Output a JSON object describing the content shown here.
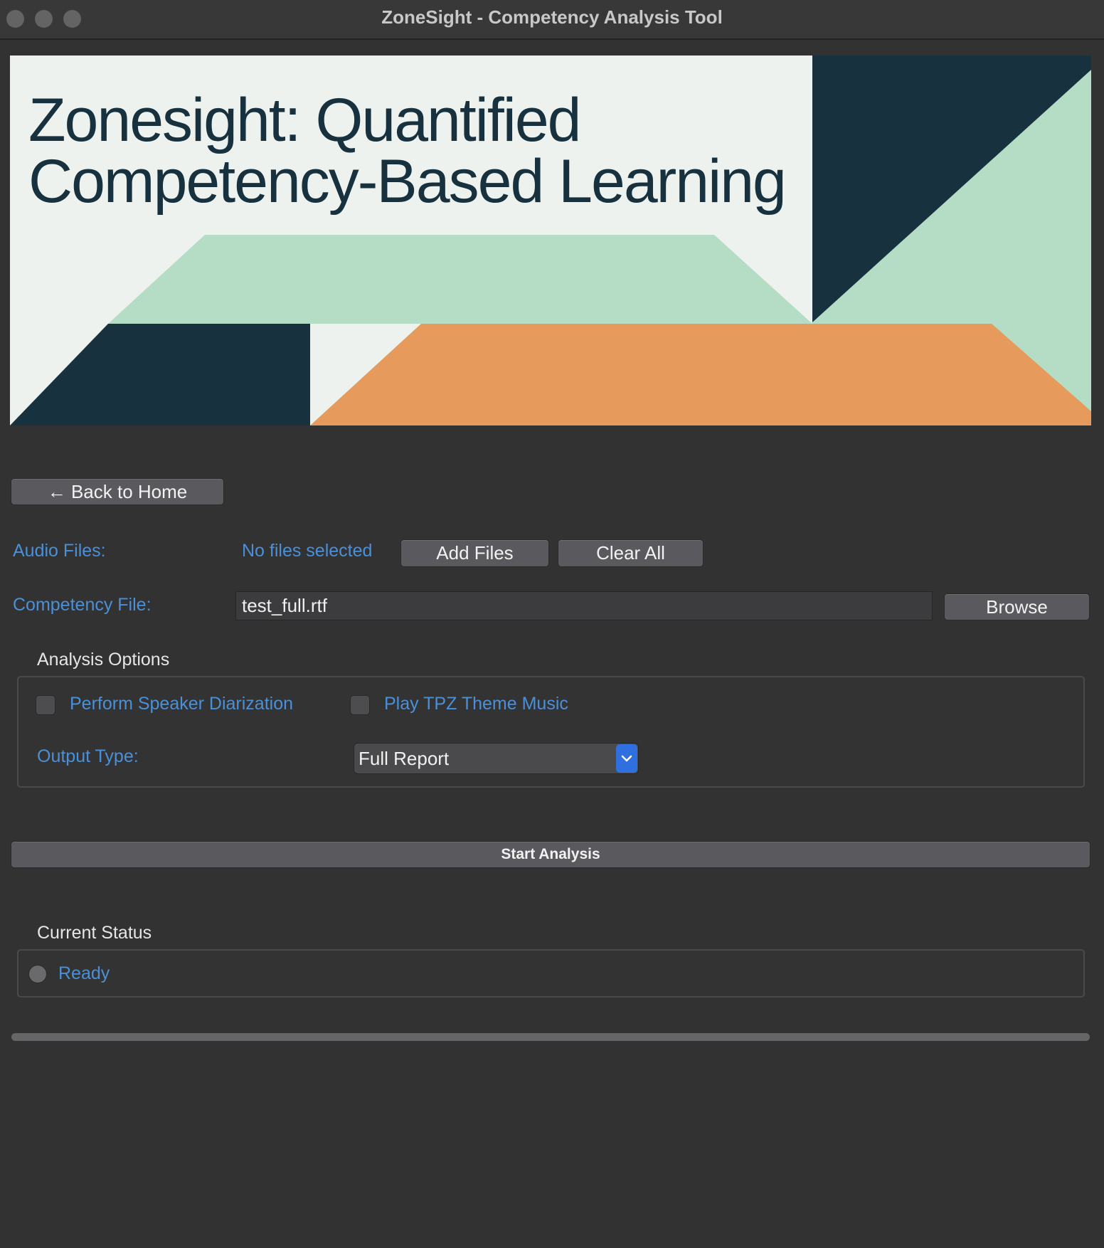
{
  "window": {
    "title": "ZoneSight - Competency Analysis Tool"
  },
  "banner": {
    "title": "Zonesight: Quantified\nCompetency-Based Learning"
  },
  "nav": {
    "back_label": "← Back to Home"
  },
  "audio": {
    "label": "Audio Files:",
    "status": "No files selected",
    "add_label": "Add Files",
    "clear_label": "Clear All"
  },
  "competency": {
    "label": "Competency File:",
    "value": "test_full.rtf",
    "browse_label": "Browse"
  },
  "options": {
    "heading": "Analysis Options",
    "diarization_label": "Perform Speaker Diarization",
    "diarization_checked": false,
    "music_label": "Play TPZ Theme Music",
    "music_checked": false,
    "output_type_label": "Output Type:",
    "output_type_value": "Full Report"
  },
  "actions": {
    "start_label": "Start Analysis"
  },
  "status": {
    "heading": "Current Status",
    "text": "Ready"
  },
  "progress": {
    "value": 0
  },
  "colors": {
    "accent_label": "#4a90d9",
    "banner_navy": "#17313f",
    "banner_mint": "#b5dcc4",
    "banner_orange": "#e69b5c"
  }
}
